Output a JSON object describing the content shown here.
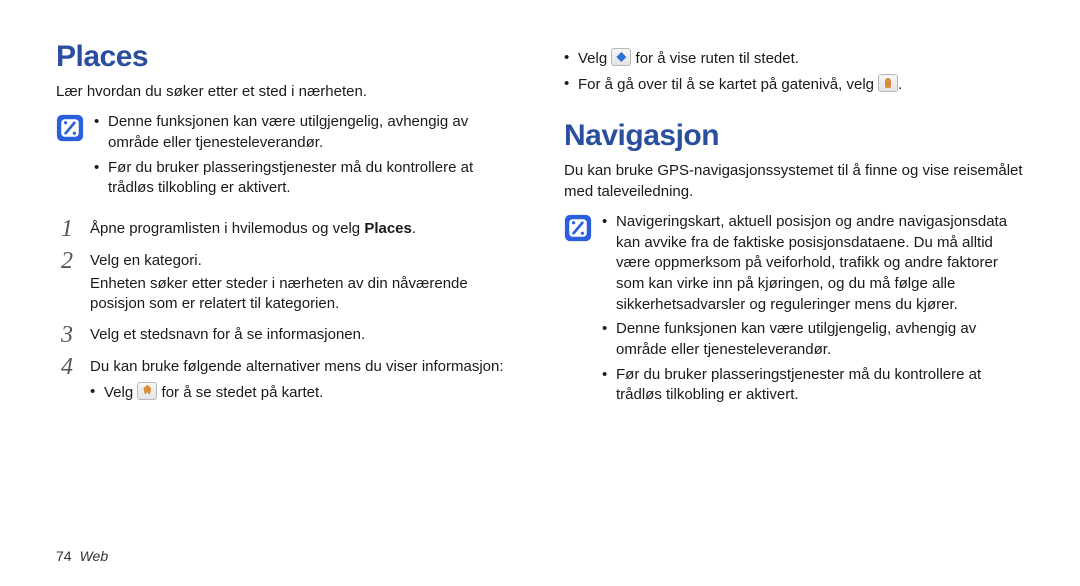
{
  "left": {
    "heading": "Places",
    "intro": "Lær hvordan du søker etter et sted i nærheten.",
    "notes": [
      "Denne funksjonen kan være utilgjengelig, avhengig av område eller tjenesteleverandør.",
      "Før du bruker plasseringstjenester må du kontrollere at trådløs tilkobling er aktivert."
    ],
    "steps": {
      "s1_a": "Åpne programlisten i hvilemodus og velg ",
      "s1_b": "Places",
      "s1_c": ".",
      "s2": "Velg en kategori.",
      "s2_extra": "Enheten søker etter steder i nærheten av din nåværende posisjon som er relatert til kategorien.",
      "s3": "Velg et stedsnavn for å se informasjonen.",
      "s4": "Du kan bruke følgende alternativer mens du viser informasjon:",
      "s4_item1_a": "Velg ",
      "s4_item1_b": " for å se stedet på kartet."
    }
  },
  "right": {
    "top_items": {
      "i1_a": "Velg ",
      "i1_b": " for å vise ruten til stedet.",
      "i2_a": "For å gå over til å se kartet på gatenivå, velg ",
      "i2_b": "."
    },
    "heading": "Navigasjon",
    "intro": "Du kan bruke GPS-navigasjonssystemet til å finne og vise reisemålet med taleveiledning.",
    "notes": [
      "Navigeringskart, aktuell posisjon og andre navigasjonsdata kan avvike fra de faktiske posisjonsdataene. Du må alltid være oppmerksom på veiforhold, trafikk og andre faktorer som kan virke inn på kjøringen, og du må følge alle sikkerhetsadvarsler og reguleringer mens du kjører.",
      "Denne funksjonen kan være utilgjengelig, avhengig av område eller tjenesteleverandør.",
      "Før du bruker plasseringstjenester må du kontrollere at trådløs tilkobling er aktivert."
    ]
  },
  "footer": {
    "page": "74",
    "section": "Web"
  }
}
